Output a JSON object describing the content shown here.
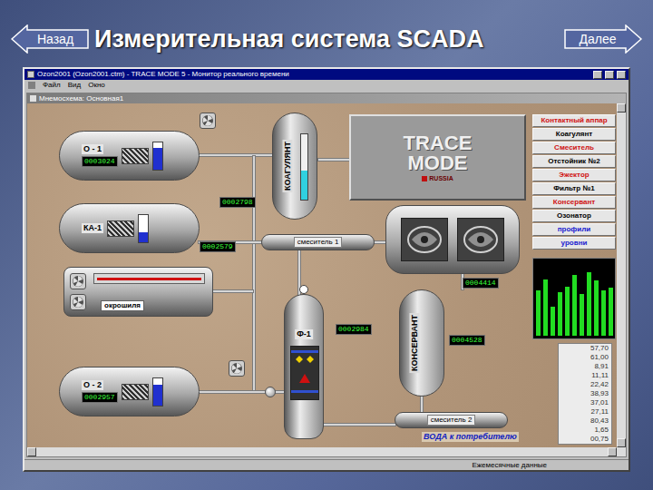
{
  "slide": {
    "title": "Измерительная система SCADA",
    "nav": [
      {
        "label": "Назад",
        "kind": "back"
      },
      {
        "label": "Далее",
        "kind": "next"
      }
    ]
  },
  "window": {
    "title": "Ozon2001 (Ozon2001.ctm) - TRACE MODE 5 - Монитор реального времени",
    "menu": [
      "Файл",
      "Вид",
      "Окно"
    ]
  },
  "mimic": {
    "title": "Мнемосхема: Основная1"
  },
  "logo": {
    "lines": [
      "TRACE",
      "MODE"
    ],
    "sub": "RUSSIA"
  },
  "tanks": [
    {
      "label": "О - 1",
      "reading": "0003024",
      "level": 0.8
    },
    {
      "label": "КА-1",
      "reading": "0002579",
      "level": 0.35
    },
    {
      "label": "О - 2",
      "reading": "0002957",
      "level": 0.75
    }
  ],
  "columns": [
    {
      "label": "КОАГУЛЯНТ",
      "reading": "0002798",
      "level": 0.45
    },
    {
      "label": "КОНСЕРВАНТ",
      "reading": "0004528"
    }
  ],
  "mixers": [
    {
      "label": "смеситель 1"
    },
    {
      "label": "смеситель 2"
    }
  ],
  "filter": {
    "label": "Ф-1",
    "reading": "0002984"
  },
  "ozonator": {
    "reading": "0004414"
  },
  "furnace": {
    "label": "окрошиля"
  },
  "outlet": {
    "label": "ВОДА к потребителю"
  },
  "menu_buttons": [
    {
      "label": "Контактный аппар",
      "color": "#d01010"
    },
    {
      "label": "Коагулянт",
      "color": "#000000"
    },
    {
      "label": "Смеситель",
      "color": "#d01010"
    },
    {
      "label": "Отстойник №2",
      "color": "#000000"
    },
    {
      "label": "Эжектор",
      "color": "#d01010"
    },
    {
      "label": "Фильтр №1",
      "color": "#000000"
    },
    {
      "label": "Консервант",
      "color": "#d01010"
    },
    {
      "label": "Озонатор",
      "color": "#000000"
    },
    {
      "label": "профили",
      "color": "#1a1ad0"
    },
    {
      "label": "уровни",
      "color": "#1a1ad0"
    }
  ],
  "chart": {
    "values": [
      62,
      78,
      40,
      60,
      68,
      84,
      58,
      88,
      76,
      62,
      66
    ]
  },
  "readings": [
    "57,70",
    "61,00",
    "8,91",
    "11,11",
    "22,42",
    "38,93",
    "37,01",
    "27,11",
    "80,43",
    "1,65",
    "00,75"
  ],
  "status_bar": "Ежемесячные данные"
}
